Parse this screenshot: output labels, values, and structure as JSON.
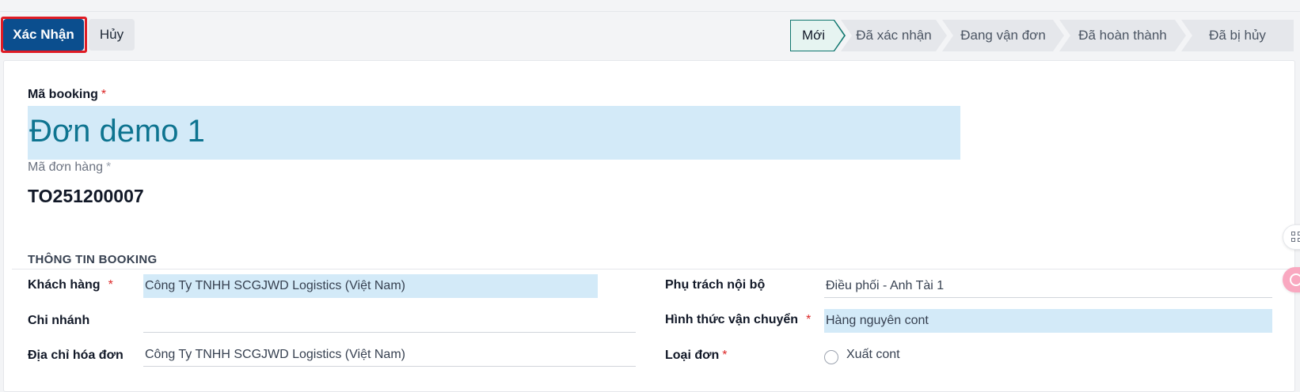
{
  "toolbar": {
    "confirm_label": "Xác Nhận",
    "cancel_label": "Hủy"
  },
  "statusbar": {
    "stages": [
      "Mới",
      "Đã xác nhận",
      "Đang vận đơn",
      "Đã hoàn thành",
      "Đã bị hủy"
    ],
    "active": "Mới"
  },
  "form": {
    "booking_code_label": "Mã booking",
    "booking_code_value": "Đơn demo 1",
    "order_code_label": "Mã đơn hàng",
    "order_code_value": "TO251200007",
    "required_mark": "*",
    "section_title": "THÔNG TIN BOOKING",
    "customer_label": "Khách hàng",
    "customer_value": "Công Ty TNHH SCGJWD Logistics (Việt Nam)",
    "branch_label": "Chi nhánh",
    "branch_value": "",
    "billing_address_label": "Địa chỉ hóa đơn",
    "billing_address_value": "Công Ty TNHH SCGJWD Logistics (Việt Nam)",
    "internal_owner_label": "Phụ trách nội bộ",
    "internal_owner_value": "Điều phối - Anh Tài 1",
    "shipping_method_label": "Hình thức vận chuyển",
    "shipping_method_value": "Hàng nguyên cont",
    "order_type_label": "Loại đơn",
    "order_type_option": "Xuất cont"
  },
  "colors": {
    "primary": "#0b4e8e",
    "highlight_field": "#d3eaf8",
    "title_text": "#0e7490",
    "required": "#dc2626",
    "focus_outline": "#e01b24"
  }
}
